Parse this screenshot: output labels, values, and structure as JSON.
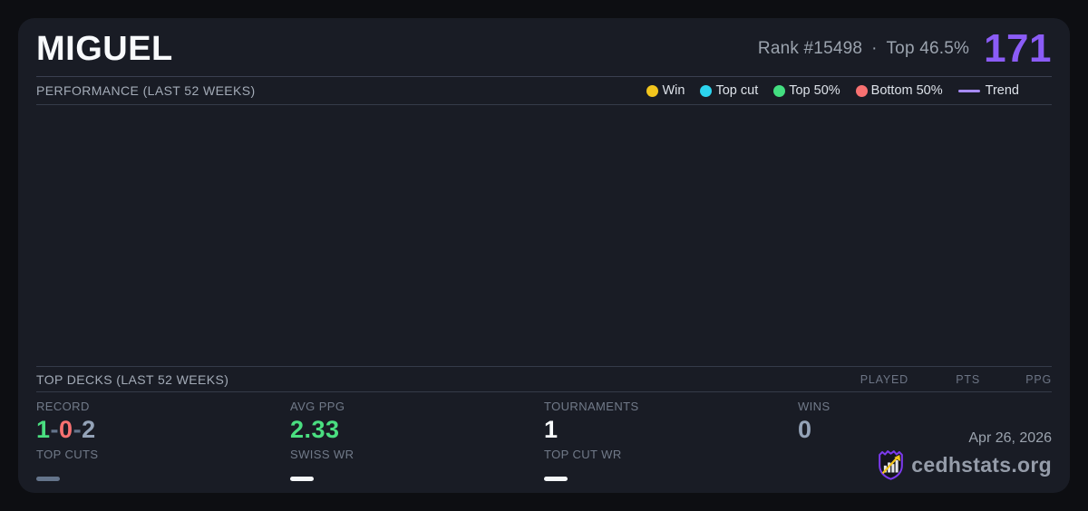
{
  "header": {
    "player_name": "MIGUEL",
    "rank": "Rank #15498",
    "separator": "·",
    "percentile": "Top 46.5%",
    "rating": "171",
    "rating_color": "#8b5cf6"
  },
  "performance": {
    "title": "PERFORMANCE (LAST 52 WEEKS)",
    "legend": {
      "win": {
        "label": "Win",
        "color": "#f2c51d",
        "icon": "win-dot"
      },
      "top_cut": {
        "label": "Top cut",
        "color": "#2cd4ee",
        "icon": "top-cut-dot"
      },
      "top_50": {
        "label": "Top 50%",
        "color": "#43de80",
        "icon": "top-50-dot"
      },
      "bottom_50": {
        "label": "Bottom 50%",
        "color": "#f87171",
        "icon": "bottom-50-dot"
      },
      "trend": {
        "label": "Trend",
        "color": "#a78bfa",
        "icon": "trend-line"
      }
    },
    "chart_data": {
      "type": "scatter",
      "points": [],
      "note_visible_points": 0
    }
  },
  "top_decks": {
    "title": "TOP DECKS (LAST 52 WEEKS)",
    "columns": {
      "played": "PLAYED",
      "pts": "PTS",
      "ppg": "PPG"
    },
    "rows": []
  },
  "stats": {
    "record": {
      "label": "RECORD",
      "value": "1-0-2",
      "parts": [
        {
          "text": "1",
          "color": "#4ade80"
        },
        {
          "text": "-",
          "color": "#64748b"
        },
        {
          "text": "0",
          "color": "#f87171"
        },
        {
          "text": "-",
          "color": "#64748b"
        },
        {
          "text": "2",
          "color": "#94a3b8"
        }
      ]
    },
    "avg_ppg": {
      "label": "AVG PPG",
      "value": "2.33",
      "color": "#4ade80"
    },
    "tournaments": {
      "label": "TOURNAMENTS",
      "value": "1",
      "color": "#f8fafc"
    },
    "wins": {
      "label": "WINS",
      "value": "0",
      "color": "#94a3b8"
    },
    "top_cuts": {
      "label": "TOP CUTS",
      "value": "—",
      "color": "#64748b"
    },
    "swiss_wr": {
      "label": "SWISS WR",
      "value": "—",
      "color": "#f4f6f8"
    },
    "top_cut_wr": {
      "label": "TOP CUT WR",
      "value": "—",
      "color": "#f4f6f8"
    }
  },
  "footer": {
    "date": "Apr 26, 2026",
    "brand": "cedhstats.org",
    "logo_colors": {
      "shield": "#7c3aed",
      "bars": "#e5e7eb",
      "arrow": "#f2c51d"
    }
  }
}
